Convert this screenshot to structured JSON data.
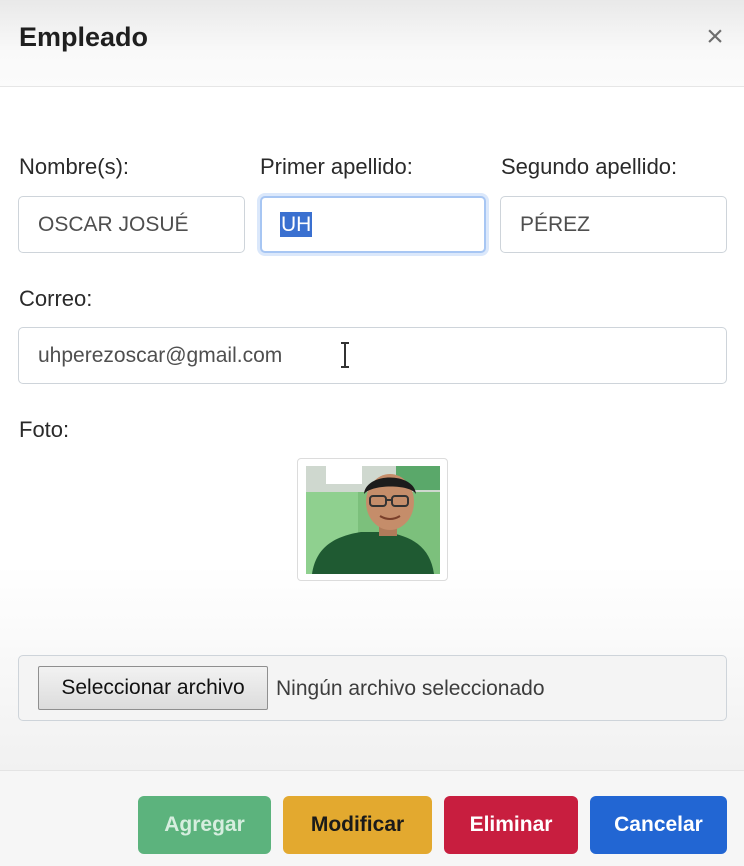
{
  "modal": {
    "title": "Empleado",
    "close_label": "×"
  },
  "form": {
    "nombre": {
      "label": "Nombre(s):",
      "value": "OSCAR JOSUÉ"
    },
    "primer_apellido": {
      "label": "Primer apellido:",
      "value": "UH"
    },
    "segundo_apellido": {
      "label": "Segundo apellido:",
      "value": "PÉREZ"
    },
    "correo": {
      "label": "Correo:",
      "value": "uhperezoscar@gmail.com"
    },
    "foto": {
      "label": "Foto:"
    },
    "archivo": {
      "button_label": "Seleccionar archivo",
      "status": "Ningún archivo seleccionado"
    }
  },
  "buttons": {
    "agregar": {
      "label": "Agregar",
      "color": "#5cb37d"
    },
    "modificar": {
      "label": "Modificar",
      "color": "#e3a92f"
    },
    "eliminar": {
      "label": "Eliminar",
      "color": "#c81e3f"
    },
    "cancelar": {
      "label": "Cancelar",
      "color": "#2266d3"
    }
  },
  "icons": {
    "close": "close-icon",
    "text_cursor": "text-cursor-icon"
  }
}
